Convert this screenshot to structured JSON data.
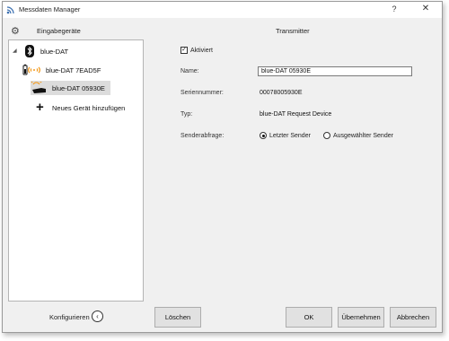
{
  "window": {
    "title": "Messdaten Manager",
    "help_label": "?",
    "close_label": "✕"
  },
  "left_panel": {
    "header": "Eingabegeräte",
    "tree": [
      {
        "label": "blue-DAT",
        "icon": "bluetooth-icon"
      },
      {
        "label": "blue-DAT 7EAD5F",
        "icon": "battery-wireless-icon"
      },
      {
        "label": "blue-DAT 05930E",
        "icon": "hand-signal-icon",
        "selected": true
      },
      {
        "label": "Neues Gerät hinzufügen",
        "icon": "plus-icon"
      }
    ],
    "configure_label": "Konfigurieren"
  },
  "right_panel": {
    "header": "Transmitter",
    "activated_label": "Aktiviert",
    "activated": true,
    "name_label": "Name:",
    "name_value": "blue-DAT 05930E",
    "serial_label": "Seriennummer:",
    "serial_value": "00078005930E",
    "type_label": "Typ:",
    "type_value": "blue-DAT Request Device",
    "sender_label": "Senderabfrage:",
    "sender_options": [
      "Letzter Sender",
      "Ausgewählter Sender"
    ],
    "sender_selected": "Letzter Sender"
  },
  "buttons": {
    "delete": "Löschen",
    "ok": "OK",
    "apply": "Übernehmen",
    "cancel": "Abbrechen"
  },
  "colors": {
    "selection": "#dcdcdc",
    "wireless_orange": "#f39a1d",
    "window_bg": "#f0f0f0"
  }
}
